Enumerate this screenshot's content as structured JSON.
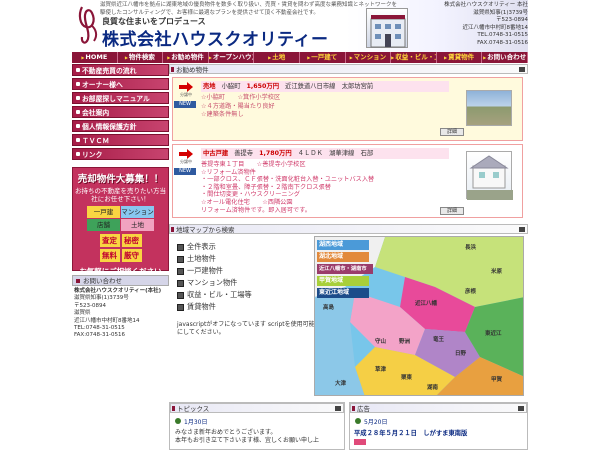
{
  "header": {
    "intro": "滋賀県近江八幡市を拠点に湖東地域の優良物件を数多く取り扱い、売買・賃貸を問わず高度な業務知識とネットワークを駆使したコンサルティングで、お客様に最適なプランを提供させて頂く不動産会社です。",
    "tagline": "良質な住まいをプロデュース",
    "company": "株式会社ハウスクオリティー",
    "address": [
      "株式会社ハウスクオリティー 本社",
      "滋賀県知事(1)3739号",
      "〒523-0894",
      "近江八幡市中村町8番地14",
      "TEL.0748-31-0515",
      "FAX.0748-31-0516"
    ]
  },
  "nav": [
    {
      "label": "HOME"
    },
    {
      "label": "物件検索"
    },
    {
      "label": "お勧め物件"
    },
    {
      "label": "オープンハウス情報"
    },
    {
      "label": "土地"
    },
    {
      "label": "一戸建て"
    },
    {
      "label": "マンション"
    },
    {
      "label": "収益・ビル・工場等"
    },
    {
      "label": "賃貸物件"
    },
    {
      "label": "お問い合わせ"
    }
  ],
  "sidebar": {
    "items": [
      "不動産売買の流れ",
      "オーナー様へ",
      "お部屋探しマニュアル",
      "会社案内",
      "個人情報保護方針",
      "ＴＶＣＭ",
      "リンク"
    ],
    "promo": {
      "title": "売却物件大募集！！",
      "sub": "お持ちの不動産を売りたい方当社にお任せ下さい！",
      "types": [
        "一戸建",
        "マンション",
        "店舗",
        "土地"
      ],
      "features": [
        "査定",
        "秘密",
        "無料",
        "厳守"
      ],
      "footer": "お気軽にご相談ください"
    },
    "contact": {
      "heading": "お問い合わせ",
      "name": "株式会社ハウスクオリティー(本社)",
      "lines": [
        "滋賀県知事(1)3739号",
        "〒523-0894",
        "滋賀県",
        "近江八幡市中村町8番地14",
        "TEL:0748-31-0515",
        "FAX:0748-31-0516"
      ]
    }
  },
  "recommend": {
    "heading": "お勧め物件",
    "listings": [
      {
        "type": "売地",
        "area": "小脇町",
        "price": "1,650万円",
        "location": "近江鉄道八日市線　太郎坊宮前",
        "tag": "分譲中",
        "badge": "NEW",
        "lines": [
          "☆小脇町　　☆箕作小学校区",
          "☆４方道路・陽当たり良好",
          "☆建築条件無し"
        ],
        "detail": "詳細"
      },
      {
        "type": "中古戸建",
        "area": "善提寺",
        "price": "1,780万円",
        "location": "４ＬＤＫ　湖華津線　石部",
        "tag": "分譲中",
        "badge": "NEW",
        "lines": [
          "善提寺東１丁目　　☆善提寺小学校区",
          "☆リフォーム済物件",
          "・一部クロス、ＣＦ張替・洗面化粧台入替・ユニットバス入替",
          "・２階和室畳、障子張替・２階南下クロス張替",
          "・間仕切変更・ハウスクリーニング",
          "☆オール電化住宅　　☆西隣公園",
          "リフォーム済物件です。即入居可です。"
        ],
        "detail": "詳細"
      }
    ]
  },
  "mapsearch": {
    "heading": "地域マップから検索",
    "items": [
      "全件表示",
      "土地物件",
      "一戸建物件",
      "マンション物件",
      "収益・ビル・工場等",
      "賃貸物件"
    ],
    "jsnote": "javascriptがオフになっています scriptを使用可能にしてください。",
    "regions": [
      "湖西地域",
      "湖北地域",
      "近江八幡市・湖南市",
      "甲賀地域",
      "東近江地域"
    ],
    "areas": [
      "高島",
      "長浜",
      "米原",
      "彦根",
      "東近江",
      "甲賀",
      "草津",
      "守山",
      "栗東",
      "近江八幡",
      "日野",
      "竜王",
      "野洲",
      "大津",
      "湖南"
    ]
  },
  "topics": {
    "heading": "トピックス",
    "date": "1月30日",
    "lines": [
      "みなさま新年おめでとうございます。",
      "本年もお引き立て下さいます様、宜しくお願い申し上"
    ]
  },
  "ads": {
    "heading": "広告",
    "date": "5月20日",
    "line": "平成２８年５月２１日　しがすま東南版"
  },
  "colors": {
    "nav": "#8a1538",
    "accent": "#c3325e",
    "brand": "#0b2a82",
    "price": "#cc0000"
  }
}
